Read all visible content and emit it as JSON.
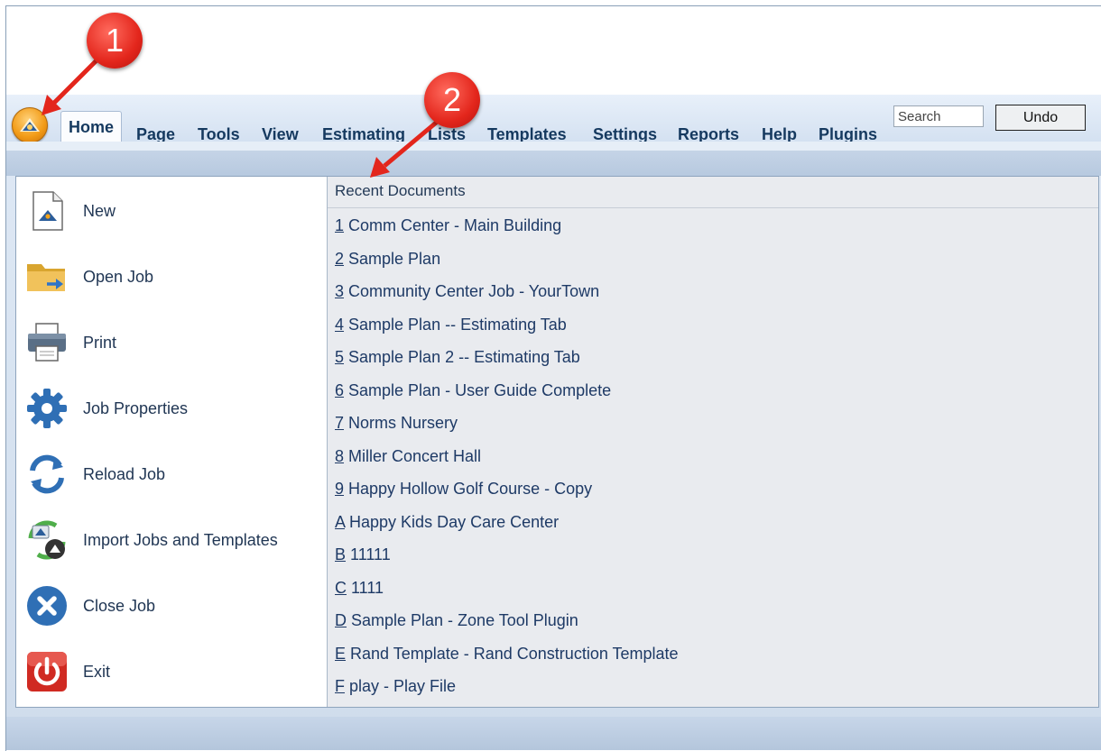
{
  "ribbon": {
    "tabs": [
      {
        "label": "Home"
      },
      {
        "label": "Page"
      },
      {
        "label": "Tools"
      },
      {
        "label": "View"
      },
      {
        "label": "Estimating"
      },
      {
        "label": "Lists"
      },
      {
        "label": "Templates"
      },
      {
        "label": "Settings"
      },
      {
        "label": "Reports"
      },
      {
        "label": "Help"
      },
      {
        "label": "Plugins"
      }
    ],
    "active_tab": "Home",
    "search_placeholder": "Search",
    "undo_label": "Undo",
    "app_button_icon": "app-orb-icon"
  },
  "menu": {
    "items": [
      {
        "label": "New",
        "icon": "new-document-icon"
      },
      {
        "label": "Open Job",
        "icon": "open-folder-icon"
      },
      {
        "label": "Print",
        "icon": "printer-icon"
      },
      {
        "label": "Job Properties",
        "icon": "gear-icon"
      },
      {
        "label": "Reload Job",
        "icon": "reload-icon"
      },
      {
        "label": "Import Jobs and Templates",
        "icon": "import-icon"
      },
      {
        "label": "Close Job",
        "icon": "close-circle-icon"
      },
      {
        "label": "Exit",
        "icon": "power-icon"
      }
    ]
  },
  "recent": {
    "title": "Recent Documents",
    "docs": [
      {
        "key": "1",
        "name": " Comm Center - Main Building"
      },
      {
        "key": "2",
        "name": " Sample Plan"
      },
      {
        "key": "3",
        "name": " Community Center Job - YourTown"
      },
      {
        "key": "4",
        "name": " Sample Plan -- Estimating Tab"
      },
      {
        "key": "5",
        "name": " Sample Plan 2 -- Estimating Tab"
      },
      {
        "key": "6",
        "name": " Sample Plan - User Guide Complete"
      },
      {
        "key": "7",
        "name": " Norms Nursery"
      },
      {
        "key": "8",
        "name": " Miller Concert Hall"
      },
      {
        "key": "9",
        "name": " Happy Hollow Golf Course - Copy"
      },
      {
        "key": "A",
        "name": " Happy Kids Day Care Center"
      },
      {
        "key": "B",
        "name": " 11111"
      },
      {
        "key": "C",
        "name": " 1111"
      },
      {
        "key": "D",
        "name": " Sample Plan - Zone Tool Plugin"
      },
      {
        "key": "E",
        "name": " Rand Template - Rand Construction Template"
      },
      {
        "key": "F",
        "name": " play - Play File"
      }
    ]
  },
  "callouts": [
    {
      "label": "1"
    },
    {
      "label": "2"
    }
  ],
  "colors": {
    "accent": "#1e3a66",
    "callout": "#e3261c",
    "ribbon": "#d4e1f1"
  }
}
